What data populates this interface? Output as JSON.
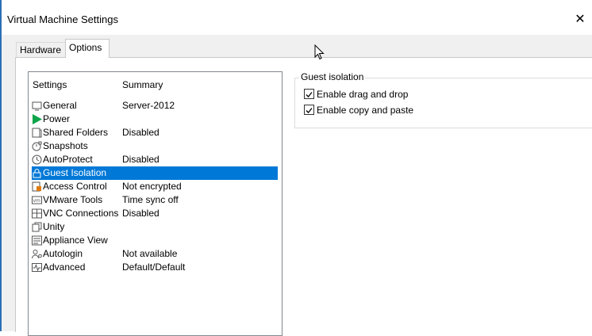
{
  "window": {
    "title": "Virtual Machine Settings",
    "close_glyph": "✕"
  },
  "tabs": [
    {
      "label": "Hardware",
      "active": false
    },
    {
      "label": "Options",
      "active": true
    }
  ],
  "list": {
    "header_settings": "Settings",
    "header_summary": "Summary",
    "items": [
      {
        "name": "General",
        "summary": "Server-2012",
        "icon": "general-icon"
      },
      {
        "name": "Power",
        "summary": "",
        "icon": "power-play-icon"
      },
      {
        "name": "Shared Folders",
        "summary": "Disabled",
        "icon": "shared-folders-icon"
      },
      {
        "name": "Snapshots",
        "summary": "",
        "icon": "snapshots-icon"
      },
      {
        "name": "AutoProtect",
        "summary": "Disabled",
        "icon": "autoprotect-clock-icon"
      },
      {
        "name": "Guest Isolation",
        "summary": "",
        "icon": "lock-icon",
        "selected": true
      },
      {
        "name": "Access Control",
        "summary": "Not encrypted",
        "icon": "access-control-icon"
      },
      {
        "name": "VMware Tools",
        "summary": "Time sync off",
        "icon": "vmware-tools-icon"
      },
      {
        "name": "VNC Connections",
        "summary": "Disabled",
        "icon": "vnc-icon"
      },
      {
        "name": "Unity",
        "summary": "",
        "icon": "unity-icon"
      },
      {
        "name": "Appliance View",
        "summary": "",
        "icon": "appliance-view-icon"
      },
      {
        "name": "Autologin",
        "summary": "Not available",
        "icon": "autologin-icon"
      },
      {
        "name": "Advanced",
        "summary": "Default/Default",
        "icon": "advanced-icon"
      }
    ]
  },
  "guest_isolation": {
    "title": "Guest isolation",
    "options": [
      {
        "label": "Enable drag and drop",
        "checked": true
      },
      {
        "label": "Enable copy and paste",
        "checked": true
      }
    ]
  },
  "colors": {
    "selection": "#0078d7",
    "window_border": "#2b6fb6",
    "power_green": "#0ea44a"
  }
}
